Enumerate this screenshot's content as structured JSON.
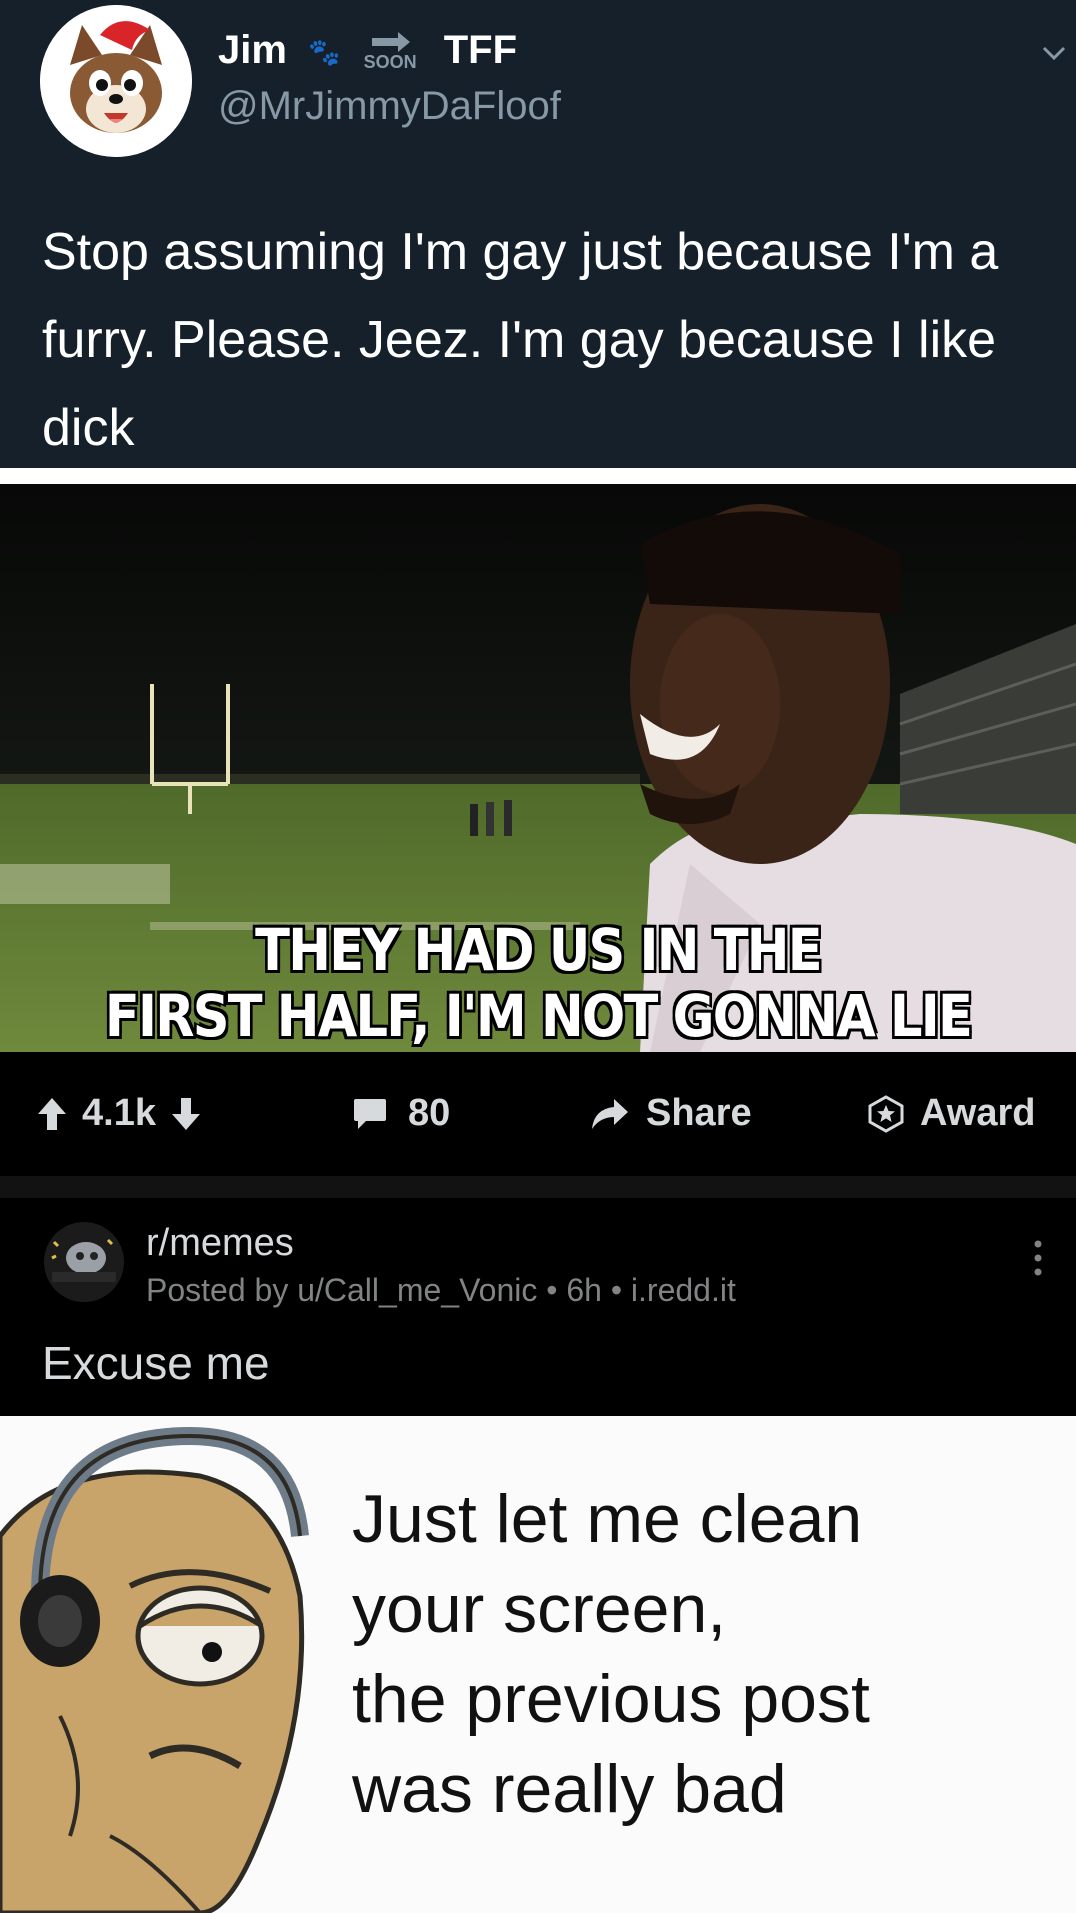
{
  "tweet": {
    "name": "Jim",
    "badge_soon": "SOON",
    "name_suffix": "TFF",
    "handle": "@MrJimmyDaFloof",
    "text": "Stop assuming I'm gay just because I'm a furry. Please. Jeez. I'm gay because I like dick"
  },
  "meme1": {
    "caption_line1": "THEY HAD US IN THE",
    "caption_line2": "FIRST HALF, I'M NOT GONNA LIE"
  },
  "actions": {
    "votes": "4.1k",
    "comments": "80",
    "share_label": "Share",
    "award_label": "Award"
  },
  "post": {
    "subreddit": "r/memes",
    "meta": "Posted by u/Call_me_Vonic • 6h • i.redd.it",
    "title": "Excuse me"
  },
  "meme2": {
    "line1": "Just let me clean",
    "line2": "your screen,",
    "line3": "the previous post",
    "line4": "was really bad"
  },
  "colors": {
    "tweet_bg": "#15202b",
    "text_primary": "#d7dadc",
    "text_secondary": "#818384",
    "twitter_gray": "#8899a6"
  }
}
